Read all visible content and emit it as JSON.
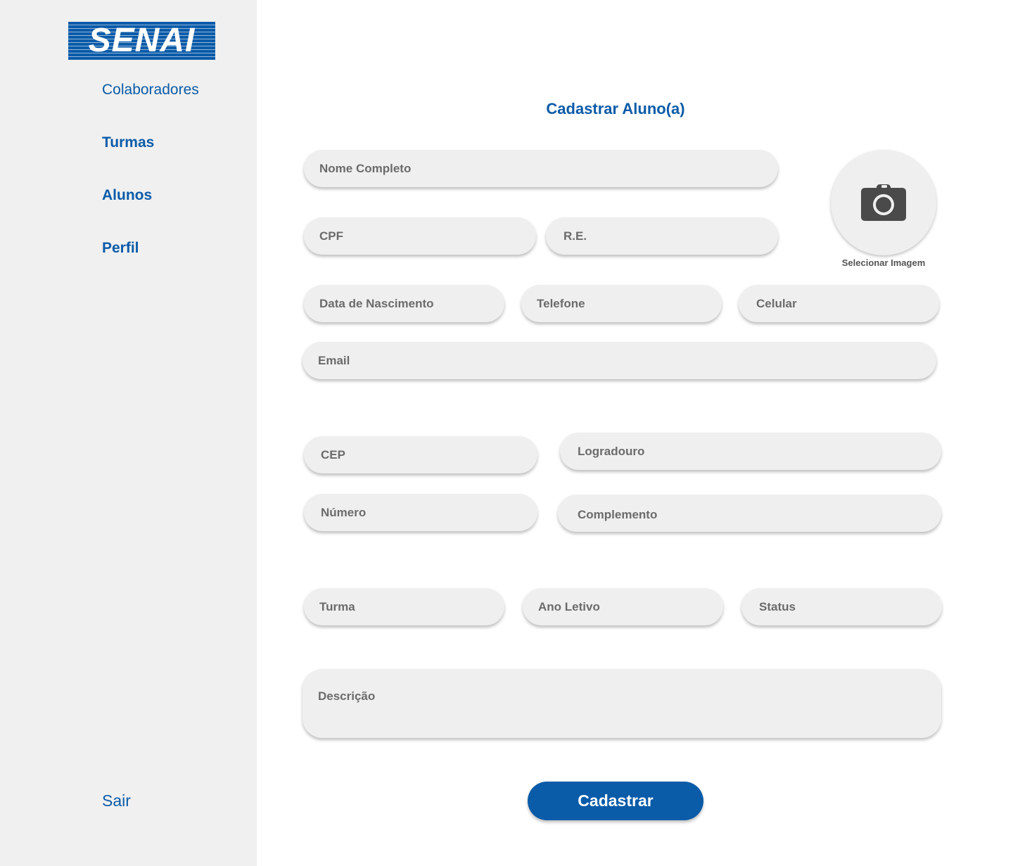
{
  "sidebar": {
    "logo_text": "SENAI",
    "items": [
      {
        "label": "Colaboradores"
      },
      {
        "label": "Turmas"
      },
      {
        "label": "Alunos"
      },
      {
        "label": "Perfil"
      }
    ],
    "logout": "Sair"
  },
  "form": {
    "title": "Cadastrar Aluno(a)",
    "fields": {
      "nome": "Nome Completo",
      "cpf": "CPF",
      "re": "R.E.",
      "data_nascimento": "Data de Nascimento",
      "telefone": "Telefone",
      "celular": "Celular",
      "email": "Email",
      "cep": "CEP",
      "logradouro": "Logradouro",
      "numero": "Número",
      "complemento": "Complemento",
      "turma": "Turma",
      "ano_letivo": "Ano Letivo",
      "status": "Status",
      "descricao": "Descrição"
    },
    "photo": {
      "label": "Selecionar Imagem",
      "icon": "camera-icon"
    },
    "submit_label": "Cadastrar"
  },
  "colors": {
    "brand": "#0a5ba8",
    "sidebar_bg": "#f0f0f0",
    "field_bg": "#efefef",
    "field_text": "#6b6b6b"
  }
}
